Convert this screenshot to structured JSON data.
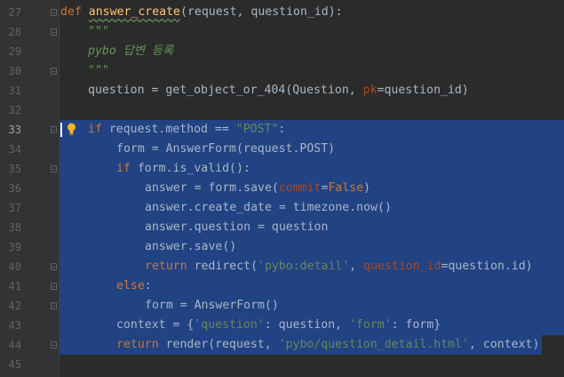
{
  "editor": {
    "line_numbers": [
      "27",
      "28",
      "29",
      "30",
      "31",
      "32",
      "33",
      "34",
      "35",
      "36",
      "37",
      "38",
      "39",
      "40",
      "41",
      "42",
      "43",
      "44",
      "45"
    ],
    "current_line": "33",
    "lines": {
      "l27": {
        "def": "def",
        "name": "answer_create",
        "params": "(request, question_id):"
      },
      "l28": {
        "doc": "\"\"\""
      },
      "l29": {
        "doc": "pybo 답변 등록"
      },
      "l30": {
        "doc": "\"\"\""
      },
      "l31": {
        "a": "question = get_object_or_404(Question, ",
        "kw": "pk",
        "b": "=question_id)"
      },
      "l33": {
        "if": "if",
        "a": " request.method == ",
        "str": "\"POST\"",
        "b": ":"
      },
      "l34": {
        "a": "form = AnswerForm(request.POST)"
      },
      "l35": {
        "if": "if",
        "a": " form.is_valid():"
      },
      "l36": {
        "a": "answer = form.save(",
        "kw": "commit",
        "eq": "=",
        "false": "False",
        "b": ")"
      },
      "l37": {
        "a": "answer.create_date = timezone.now()"
      },
      "l38": {
        "a": "answer.question = question"
      },
      "l39": {
        "a": "answer.save()"
      },
      "l40": {
        "ret": "return",
        "a": " redirect(",
        "str": "'pybo:detail'",
        "c": ", ",
        "kw": "question_id",
        "b": "=question.id)"
      },
      "l41": {
        "else": "else",
        "b": ":"
      },
      "l42": {
        "a": "form = AnswerForm()"
      },
      "l43": {
        "a": "context = {",
        "s1": "'question'",
        "m": ": question, ",
        "s2": "'form'",
        "b": ": form}"
      },
      "l44": {
        "ret": "return",
        "a": " render(request, ",
        "str": "'pybo/question_detail.html'",
        "b": ", context)"
      }
    }
  },
  "colors": {
    "background": "#2b2b2b",
    "gutter": "#313335",
    "selection": "#214283",
    "keyword": "#cc7832",
    "function": "#ffc66d",
    "string": "#6a8759",
    "kwarg": "#aa4926"
  }
}
